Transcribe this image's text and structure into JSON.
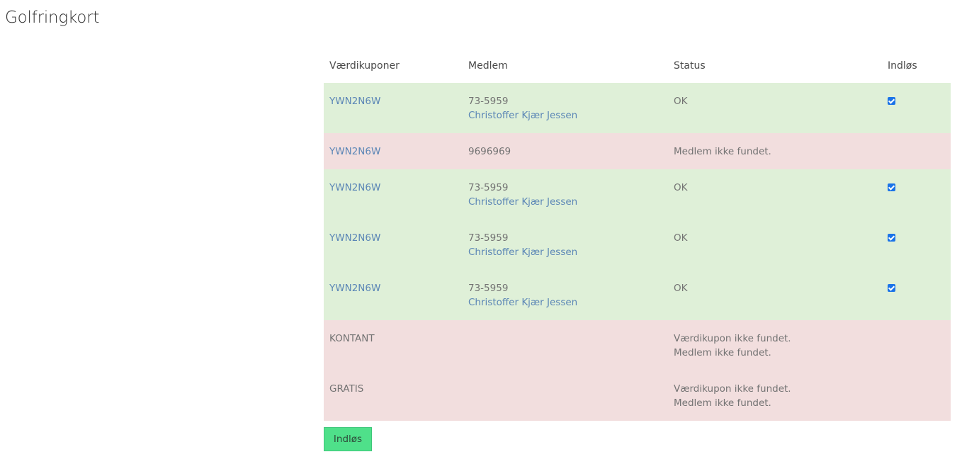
{
  "page": {
    "title": "Golfringkort"
  },
  "table": {
    "headers": {
      "code": "Værdikuponer",
      "member": "Medlem",
      "status": "Status",
      "redeem": "Indløs"
    },
    "rows": [
      {
        "code": "YWN2N6W",
        "member_id": "73-5959",
        "member_name": "Christoffer Kjær Jessen",
        "status": [
          "OK"
        ],
        "checked": true
      },
      {
        "code": "YWN2N6W",
        "member_id": "9696969",
        "member_name": "",
        "status": [
          "Medlem ikke fundet."
        ],
        "checked": false
      },
      {
        "code": "YWN2N6W",
        "member_id": "73-5959",
        "member_name": "Christoffer Kjær Jessen",
        "status": [
          "OK"
        ],
        "checked": true
      },
      {
        "code": "YWN2N6W",
        "member_id": "73-5959",
        "member_name": "Christoffer Kjær Jessen",
        "status": [
          "OK"
        ],
        "checked": true
      },
      {
        "code": "YWN2N6W",
        "member_id": "73-5959",
        "member_name": "Christoffer Kjær Jessen",
        "status": [
          "OK"
        ],
        "checked": true
      },
      {
        "code": "KONTANT",
        "member_id": "",
        "member_name": "",
        "status": [
          "Værdikupon ikke fundet.",
          "Medlem ikke fundet."
        ],
        "checked": false
      },
      {
        "code": "GRATIS",
        "member_id": "",
        "member_name": "",
        "status": [
          "Værdikupon ikke fundet.",
          "Medlem ikke fundet."
        ],
        "checked": false
      }
    ]
  },
  "actions": {
    "redeem_label": "Indløs"
  },
  "colors": {
    "ok_row": "#dff0d8",
    "error_row": "#f2dede",
    "link": "#5b86b6",
    "button": "#4fe08a",
    "checkbox": "#1a73e8"
  }
}
